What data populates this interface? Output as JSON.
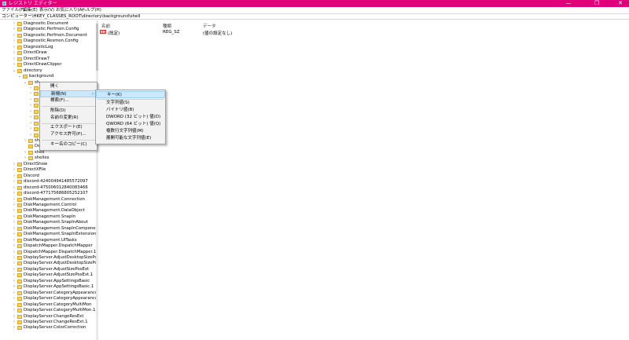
{
  "titlebar": {
    "title": "レジストリ エディター",
    "minimize": "—",
    "maximize": "❐",
    "close": "✕"
  },
  "menubar": [
    "ファイル(F)",
    "編集(E)",
    "表示(V)",
    "お気に入り(A)",
    "ヘルプ(H)"
  ],
  "address": "コンピューター\\HKEY_CLASSES_ROOT\\directory\\background\\shell",
  "tree": [
    {
      "label": "Diagnostic.Document",
      "expand": "›"
    },
    {
      "label": "Diagnostic.Perfmon.Config",
      "expand": "›"
    },
    {
      "label": "Diagnostic.Perfmon.Document",
      "expand": "›"
    },
    {
      "label": "Diagnostic.Resmon.Config",
      "expand": "›"
    },
    {
      "label": "DiagnosticLog",
      "expand": "›"
    },
    {
      "label": "DirectDraw",
      "expand": "›"
    },
    {
      "label": "DirectDraw7",
      "expand": "›"
    },
    {
      "label": "DirectDrawClipper",
      "expand": "›"
    },
    {
      "label": "directory",
      "expand": "⌄"
    },
    {
      "label": "background",
      "expand": "⌄"
    },
    {
      "label": "sh",
      "expand": "⌄"
    },
    {
      "label": "",
      "expand": "›"
    },
    {
      "label": "",
      "expand": "›"
    },
    {
      "label": "",
      "expand": "›"
    },
    {
      "label": "",
      "expand": "›"
    },
    {
      "label": "",
      "expand": "›"
    },
    {
      "label": "",
      "expand": "›"
    },
    {
      "label": "",
      "expand": "›"
    },
    {
      "label": "",
      "expand": "›"
    },
    {
      "label": "",
      "expand": "›"
    },
    {
      "label": "sh",
      "expand": "›"
    },
    {
      "label": "DefaultIcon",
      "expand": ""
    },
    {
      "label": "shell",
      "expand": "›"
    },
    {
      "label": "shellex",
      "expand": "›"
    },
    {
      "label": "DirectShow",
      "expand": "›"
    },
    {
      "label": "DirectXFile",
      "expand": "›"
    },
    {
      "label": "Discord",
      "expand": "›"
    },
    {
      "label": "discord-424004941485572097",
      "expand": "›"
    },
    {
      "label": "discord-475006012840083466",
      "expand": "›"
    },
    {
      "label": "discord-477175686805252107",
      "expand": "›"
    },
    {
      "label": "DiskManagement.Connection",
      "expand": "›"
    },
    {
      "label": "DiskManagement.Control",
      "expand": "›"
    },
    {
      "label": "DiskManagement.DataObject",
      "expand": "›"
    },
    {
      "label": "DiskManagement.SnapIn",
      "expand": "›"
    },
    {
      "label": "DiskManagement.SnapInAbout",
      "expand": "›"
    },
    {
      "label": "DiskManagement.SnapInComponent",
      "expand": "›"
    },
    {
      "label": "DiskManagement.SnapInExtension",
      "expand": "›"
    },
    {
      "label": "DiskManagement.UITasks",
      "expand": "›"
    },
    {
      "label": "DispatchMapper.DispatchMapper",
      "expand": "›"
    },
    {
      "label": "DispatchMapper.DispatchMapper.1",
      "expand": "›"
    },
    {
      "label": "DisplayServer.AdjustDesktopSizePos",
      "expand": "›"
    },
    {
      "label": "DisplayServer.AdjustDesktopSizePos.1",
      "expand": "›"
    },
    {
      "label": "DisplayServer.AdjustSizePosExt",
      "expand": "›"
    },
    {
      "label": "DisplayServer.AdjustSizePosExt.1",
      "expand": "›"
    },
    {
      "label": "DisplayServer.AppSettingsBasic",
      "expand": "›"
    },
    {
      "label": "DisplayServer.AppSettingsBasic.1",
      "expand": "›"
    },
    {
      "label": "DisplayServer.CategoryAppearance",
      "expand": "›"
    },
    {
      "label": "DisplayServer.CategoryAppearance.1",
      "expand": "›"
    },
    {
      "label": "DisplayServer.CategoryMultiMon",
      "expand": "›"
    },
    {
      "label": "DisplayServer.CategoryMultiMon.1",
      "expand": "›"
    },
    {
      "label": "DisplayServer.ChangeResExt",
      "expand": "›"
    },
    {
      "label": "DisplayServer.ChangeResExt.1",
      "expand": "›"
    },
    {
      "label": "DisplayServer.ColorCorrection",
      "expand": "›"
    }
  ],
  "values_panel": {
    "headers": {
      "name": "名前",
      "type": "種類",
      "data": "データ"
    },
    "row": {
      "icon": "ab",
      "name": "(既定)",
      "type": "REG_SZ",
      "data": "(値の設定なし)"
    }
  },
  "context_menu": {
    "items": [
      "開く",
      "新規(N)",
      "検索(F)...",
      "削除(D)",
      "名前の変更(R)",
      "エクスポート(E)",
      "アクセス許可(P)...",
      "キー名のコピー(C)"
    ],
    "submenu_arrow": "›"
  },
  "submenu": {
    "items": [
      "キー(K)",
      "文字列値(S)",
      "バイナリ値(B)",
      "DWORD (32 ビット) 値(D)",
      "QWORD (64 ビット) 値(Q)",
      "複数行文字列値(M)",
      "展開可能な文字列値(E)"
    ]
  }
}
